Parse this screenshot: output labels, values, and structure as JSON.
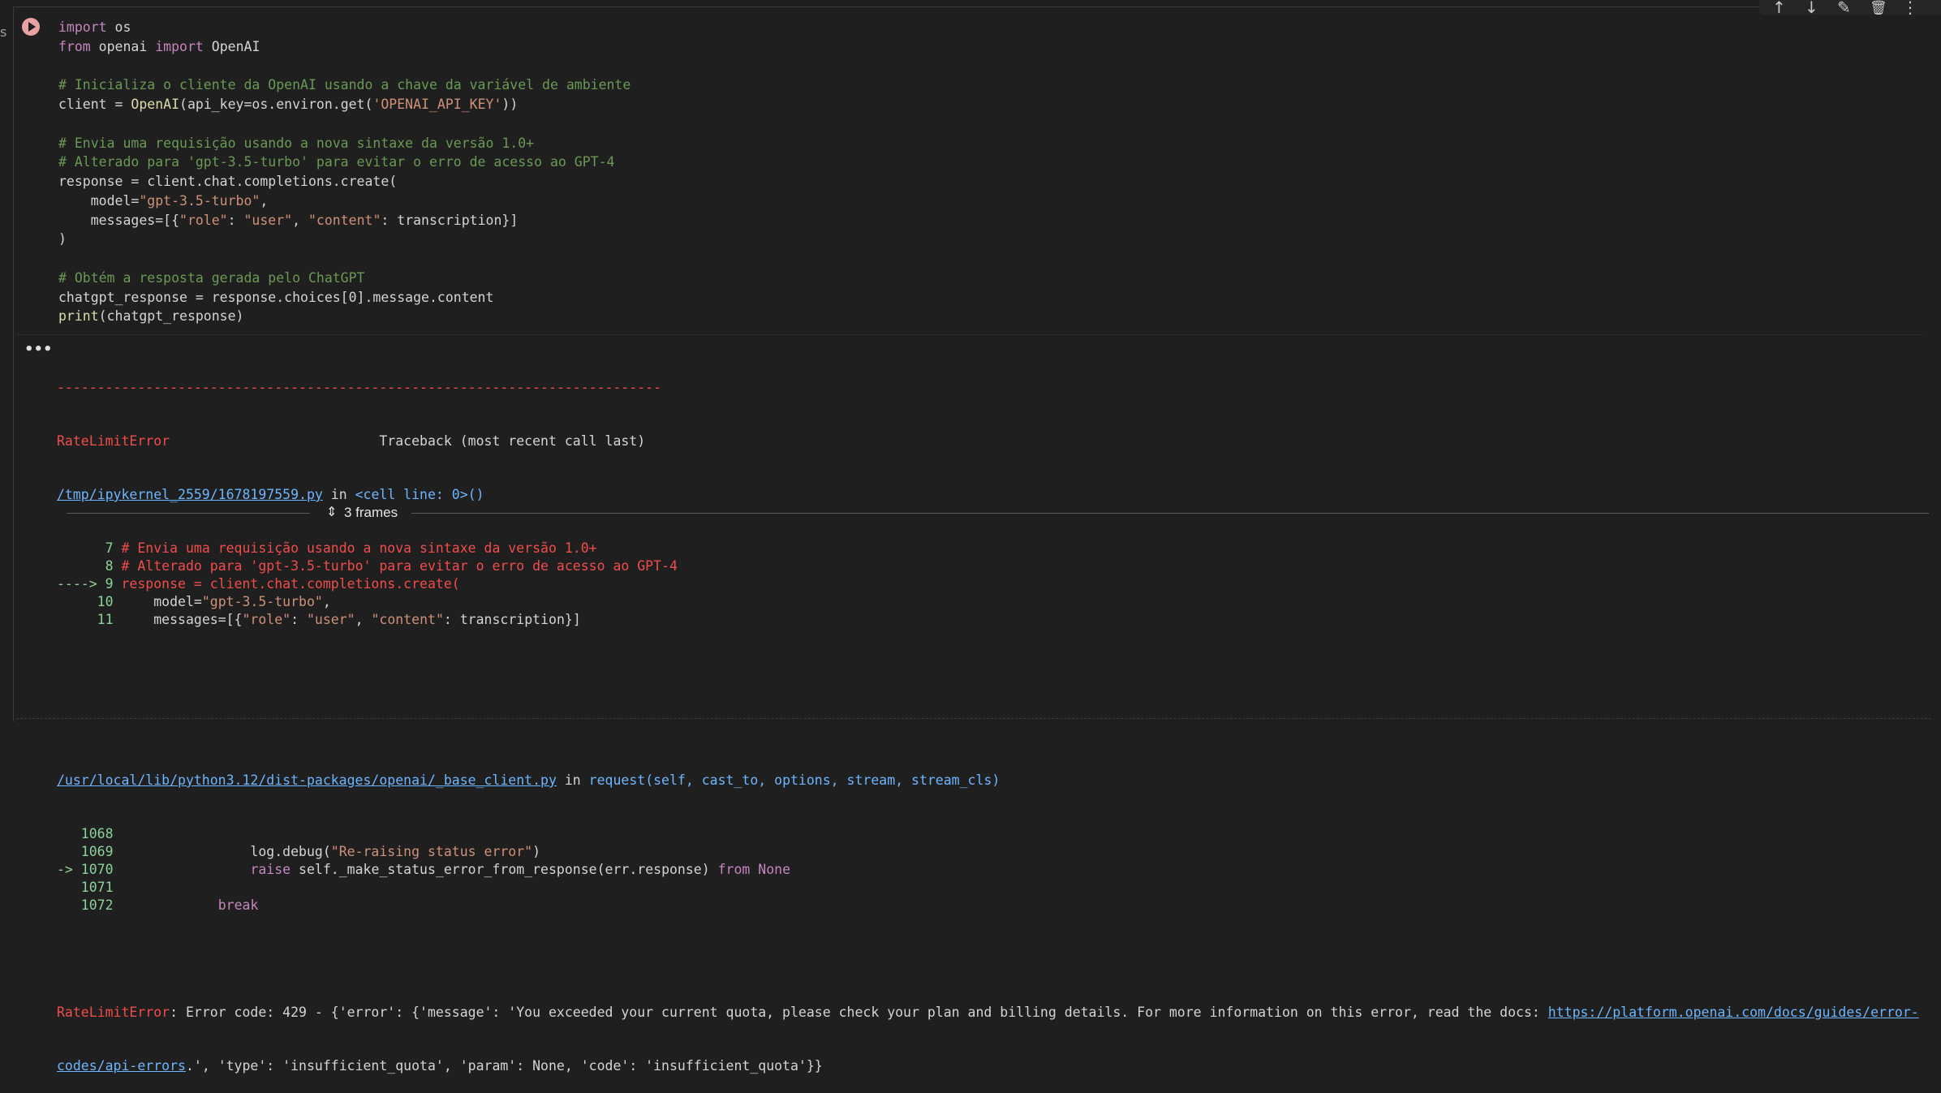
{
  "left_margin_char": "s",
  "toolbar": {
    "icons": [
      "arrow-up-icon",
      "arrow-down-icon",
      "edit-icon",
      "delete-icon",
      "more-vert-icon"
    ]
  },
  "code_lines": [
    "import os",
    "from openai import OpenAI",
    "",
    "# Inicializa o cliente da OpenAI usando a chave da variável de ambiente",
    "client = OpenAI(api_key=os.environ.get('OPENAI_API_KEY'))",
    "",
    "# Envia uma requisição usando a nova sintaxe da versão 1.0+",
    "# Alterado para 'gpt-3.5-turbo' para evitar o erro de acesso ao GPT-4",
    "response = client.chat.completions.create(",
    "    model=\"gpt-3.5-turbo\",",
    "    messages=[{\"role\": \"user\", \"content\": transcription}]",
    ")",
    "",
    "# Obtém a resposta gerada pelo ChatGPT",
    "chatgpt_response = response.choices[0].message.content",
    "print(chatgpt_response)"
  ],
  "output": {
    "dashes": "---------------------------------------------------------------------------",
    "error_name": "RateLimitError",
    "traceback_header": "Traceback (most recent call last)",
    "file1": "/tmp/ipykernel_2559/1678197559.py",
    "file1_in": " in ",
    "file1_loc": "<cell line: 0>()",
    "tb1": [
      {
        "no": "      7 ",
        "code": "# Envia uma requisição usando a nova sintaxe da versão 1.0+"
      },
      {
        "no": "      8 ",
        "code": "# Alterado para 'gpt-3.5-turbo' para evitar o erro de acesso ao GPT-4"
      },
      {
        "no": "----> 9 ",
        "code": "response = client.chat.completions.create("
      },
      {
        "no": "     10 ",
        "code": "    model=\"gpt-3.5-turbo\","
      },
      {
        "no": "     11 ",
        "code": "    messages=[{\"role\": \"user\", \"content\": transcription}]"
      }
    ],
    "frames_label": "3 frames",
    "file2": "/usr/local/lib/python3.12/dist-packages/openai/_base_client.py",
    "file2_in": " in ",
    "file2_loc": "request(self, cast_to, options, stream, stream_cls)",
    "tb2": [
      {
        "no": "   1068 ",
        "code": ""
      },
      {
        "no": "   1069 ",
        "code": "                log.debug(\"Re-raising status error\")"
      },
      {
        "no": "-> 1070 ",
        "code": "                raise self._make_status_error_from_response(err.response) from None"
      },
      {
        "no": "   1071 ",
        "code": ""
      },
      {
        "no": "   1072 ",
        "code": "            break"
      }
    ],
    "final_error_name": "RateLimitError",
    "final_error_msg_1": ": Error code: 429 - {'error': {'message': 'You exceeded your current quota, please check your plan and billing details. For more information on this error, read the docs: ",
    "final_error_link_1": "https://platform.openai.com/docs/guides/error-",
    "final_error_link_2": "codes/api-errors",
    "final_error_msg_2": ".', 'type': 'insufficient_quota', 'param': None, 'code': 'insufficient_quota'}}"
  }
}
